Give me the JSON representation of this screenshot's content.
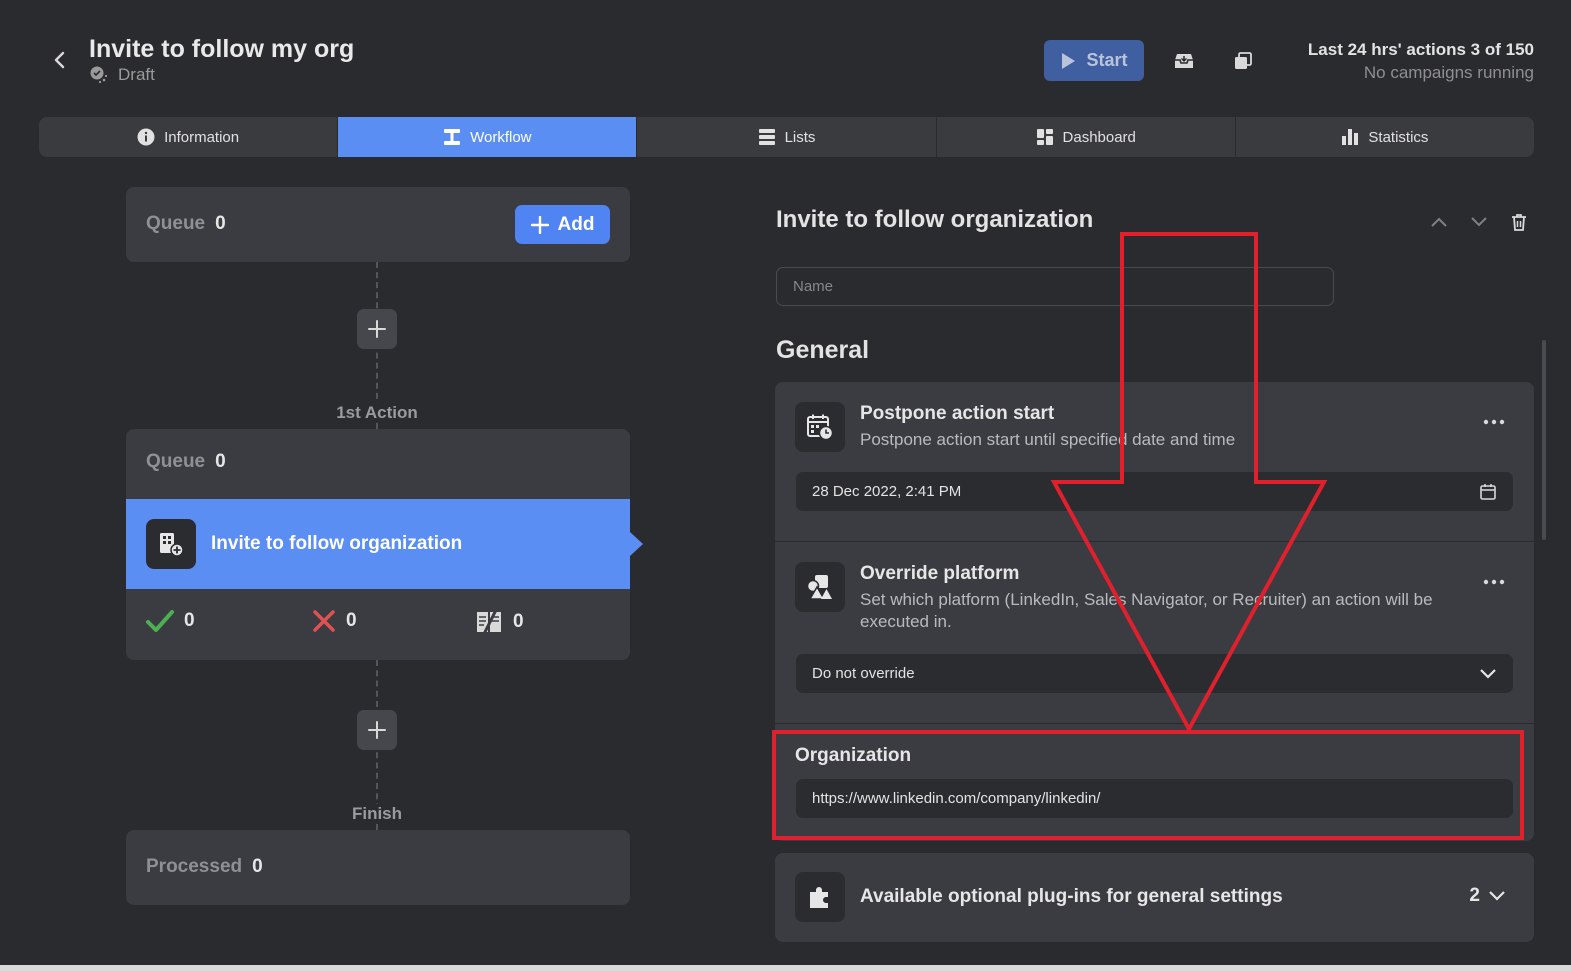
{
  "header": {
    "title": "Invite to follow my org",
    "status": "Draft",
    "start_label": "Start",
    "limits": "Last 24 hrs' actions 3 of 150",
    "running": "No campaigns running"
  },
  "tabs": [
    {
      "label": "Information",
      "icon": "info-icon"
    },
    {
      "label": "Workflow",
      "icon": "workflow-icon",
      "active": true
    },
    {
      "label": "Lists",
      "icon": "list-icon"
    },
    {
      "label": "Dashboard",
      "icon": "dashboard-icon"
    },
    {
      "label": "Statistics",
      "icon": "bar-chart-icon"
    }
  ],
  "workflow": {
    "queue_top": {
      "label": "Queue",
      "count": "0"
    },
    "add_label": "Add",
    "first_action_label": "1st Action",
    "action": {
      "queue_label": "Queue",
      "queue_count": "0",
      "title": "Invite to follow organization",
      "success": "0",
      "failed": "0",
      "skipped": "0"
    },
    "finish_label": "Finish",
    "processed": {
      "label": "Processed",
      "count": "0"
    }
  },
  "panel": {
    "title": "Invite to follow organization",
    "name_placeholder": "Name",
    "general_heading": "General",
    "postpone": {
      "title": "Postpone action start",
      "desc": "Postpone action start until specified date and time",
      "value": "28 Dec 2022, 2:41 PM"
    },
    "override": {
      "title": "Override platform",
      "desc": "Set which platform (LinkedIn, Sales Navigator, or Recruiter) an action will be executed in.",
      "value": "Do not override"
    },
    "organization": {
      "label": "Organization",
      "value": "https://www.linkedin.com/company/linkedin/"
    },
    "plugins": {
      "title": "Available optional plug-ins for general settings",
      "count": "2"
    }
  },
  "colors": {
    "background": "#2a2b2e",
    "card": "#3b3c41",
    "accent": "#5b8ef3",
    "button": "#4f84f2",
    "success": "#4caf50",
    "danger": "#e05252",
    "annotation": "#e0202c"
  }
}
